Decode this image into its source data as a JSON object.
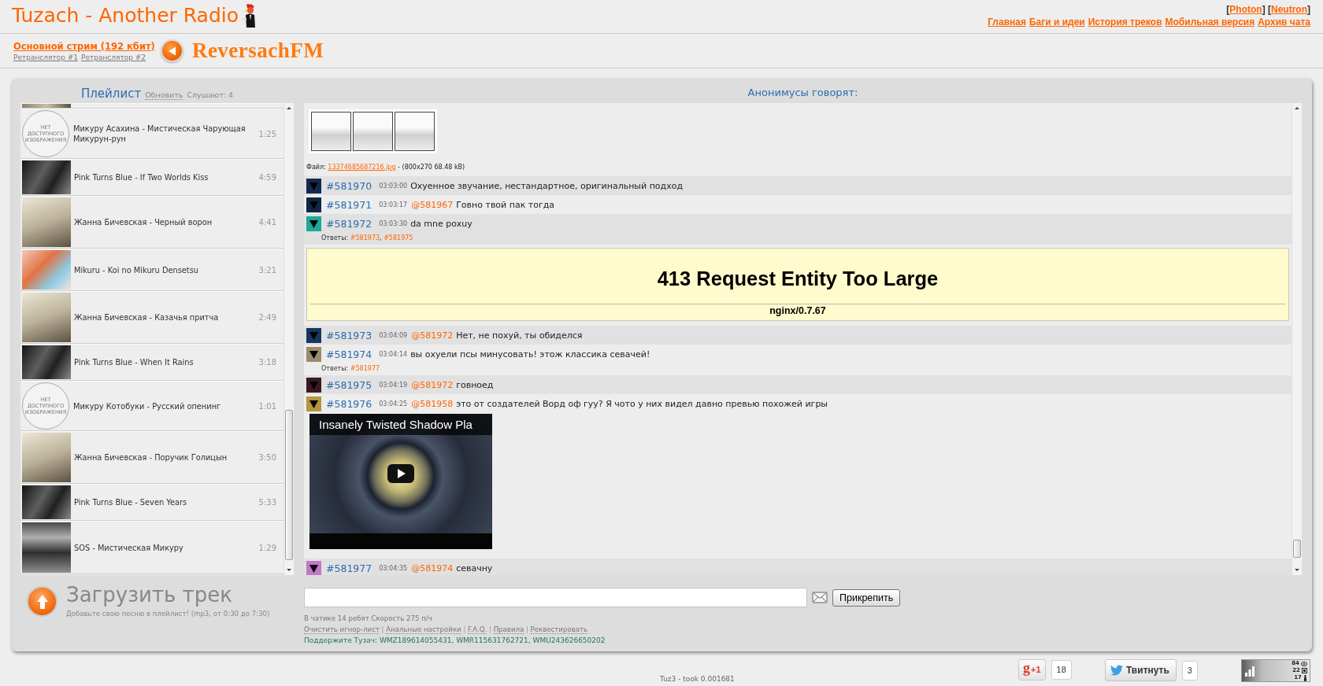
{
  "header": {
    "title": "Tuzach - Another Radio",
    "skins": {
      "open": "[",
      "close": "]",
      "items": [
        "Photon",
        "Neutron"
      ]
    },
    "nav": [
      "Главная",
      "Баги и идеи",
      "История треков",
      "Мобильная версия",
      "Архив чата"
    ]
  },
  "stream": {
    "main": "Основной стрим (192 кбит)",
    "relays": [
      "Ретранслятор #1",
      "Ретранслятор #2"
    ],
    "logo": "ReversachFM"
  },
  "playlist": {
    "title": "Плейлист",
    "refresh": "Обновить",
    "listeners": "Слушают: 4",
    "tracks": [
      {
        "kind": "no_image",
        "title": "Микуру Асахина - Мистическая Чарующая Микурун-рун",
        "duration": "1:25",
        "thumb_text": "НЕТ ДОСТУПНОГО ИЗОБРАЖЕНИЯ"
      },
      {
        "kind": "dark_photo",
        "title": "Pink Turns Blue - If Two Worlds Kiss",
        "duration": "4:59"
      },
      {
        "kind": "light_photo",
        "title": "Жанна Бичевская - Черный ворон",
        "duration": "4:41"
      },
      {
        "kind": "color_photo",
        "title": "Mikuru - Koi no Mikuru Densetsu",
        "duration": "3:21"
      },
      {
        "kind": "light_photo",
        "title": "Жанна Бичевская - Казачья притча",
        "duration": "2:49"
      },
      {
        "kind": "dark_photo",
        "title": "Pink Turns Blue - When It Rains",
        "duration": "3:18"
      },
      {
        "kind": "no_image",
        "title": "Микуру Котобуки - Русский опенинг",
        "duration": "1:01",
        "thumb_text": "НЕТ ДОСТУПНОГО ИЗОБРАЖЕНИЯ"
      },
      {
        "kind": "light_photo",
        "title": "Жанна Бичевская - Поручик Голицын",
        "duration": "3:50"
      },
      {
        "kind": "dark_photo",
        "title": "Pink Turns Blue - Seven Years",
        "duration": "5:33"
      },
      {
        "kind": "grey_photo",
        "title": "SOS - Мистическая Микуру",
        "duration": "1:29"
      }
    ]
  },
  "chat": {
    "title": "Анонимусы говорят:",
    "items": [
      {
        "kind": "attachment",
        "file": {
          "label": "Файл:",
          "name": "13374685687216.jpg",
          "info": "- (800x270 68.48 kB)"
        }
      },
      {
        "kind": "message",
        "number": "#581970",
        "time": "03:03:00",
        "color": "#142a4c",
        "text": "Охуенное звучание, нестандартное, оригинальный подход"
      },
      {
        "kind": "message",
        "number": "#581971",
        "time": "03:03:17",
        "color": "#0f2644",
        "reply_to": "@581967",
        "text": "Говно твой пак тогда"
      },
      {
        "kind": "message",
        "number": "#581972",
        "time": "03:03:30",
        "color": "#1fa898",
        "text": "da mne poxuy",
        "replies": {
          "label": "Ответы:",
          "links": [
            "#581973",
            "#581975"
          ],
          "separator": ","
        }
      },
      {
        "kind": "error_page",
        "title": "413 Request Entity Too Large",
        "footer": "nginx/0.7.67"
      },
      {
        "kind": "message",
        "number": "#581973",
        "time": "03:04:09",
        "color": "#17375e",
        "reply_to": "@581972",
        "text": "Нет, не похуй, ты обиделся"
      },
      {
        "kind": "message",
        "number": "#581974",
        "time": "03:04:14",
        "color": "#9c8c6c",
        "text": "вы охуели псы минусовать! этож классика севачей!",
        "replies": {
          "label": "Ответы:",
          "links": [
            "#581977"
          ]
        }
      },
      {
        "kind": "message",
        "number": "#581975",
        "time": "03:04:19",
        "color": "#3a1820",
        "reply_to": "@581972",
        "text": "говноед"
      },
      {
        "kind": "message",
        "number": "#581976",
        "time": "03:04:25",
        "color": "#b4943c",
        "reply_to": "@581958",
        "text": "это от создателей Ворд оф гуу? Я чото у них видел давно превью похожей игры",
        "video": {
          "title": "Insanely Twisted Shadow Pla"
        }
      },
      {
        "kind": "message",
        "number": "#581977",
        "time": "03:04:35",
        "color": "#c078c8",
        "reply_to": "@581974",
        "text": "севачну"
      }
    ]
  },
  "upload": {
    "title": "Загрузить трек",
    "hint": "Добавьте свою песню в плейлист! (mp3, от 0:30 до 7:30)"
  },
  "composer": {
    "attach": "Прикрепить",
    "stats": "В чатике 14 ребят Скорость 275 п/ч",
    "links": [
      "Очистить игнор-лист",
      "Анальные настройки",
      "F.A.Q.",
      "Правила",
      "Реквестировать"
    ],
    "separator": "|",
    "donate": "Поддержите Тузач: WMZ189614055431, WMR115631762721, WMU243626650202"
  },
  "footer": {
    "timing": "Tuz3 - took 0.001681",
    "google_plus": {
      "logo": "g",
      "label": "+1",
      "count": "18"
    },
    "tweet": {
      "label": "Твитнуть",
      "count": "3"
    },
    "counter": [
      {
        "kind": "eye",
        "value": "84"
      },
      {
        "kind": "square",
        "value": "22"
      },
      {
        "kind": "person",
        "value": "17"
      }
    ]
  }
}
